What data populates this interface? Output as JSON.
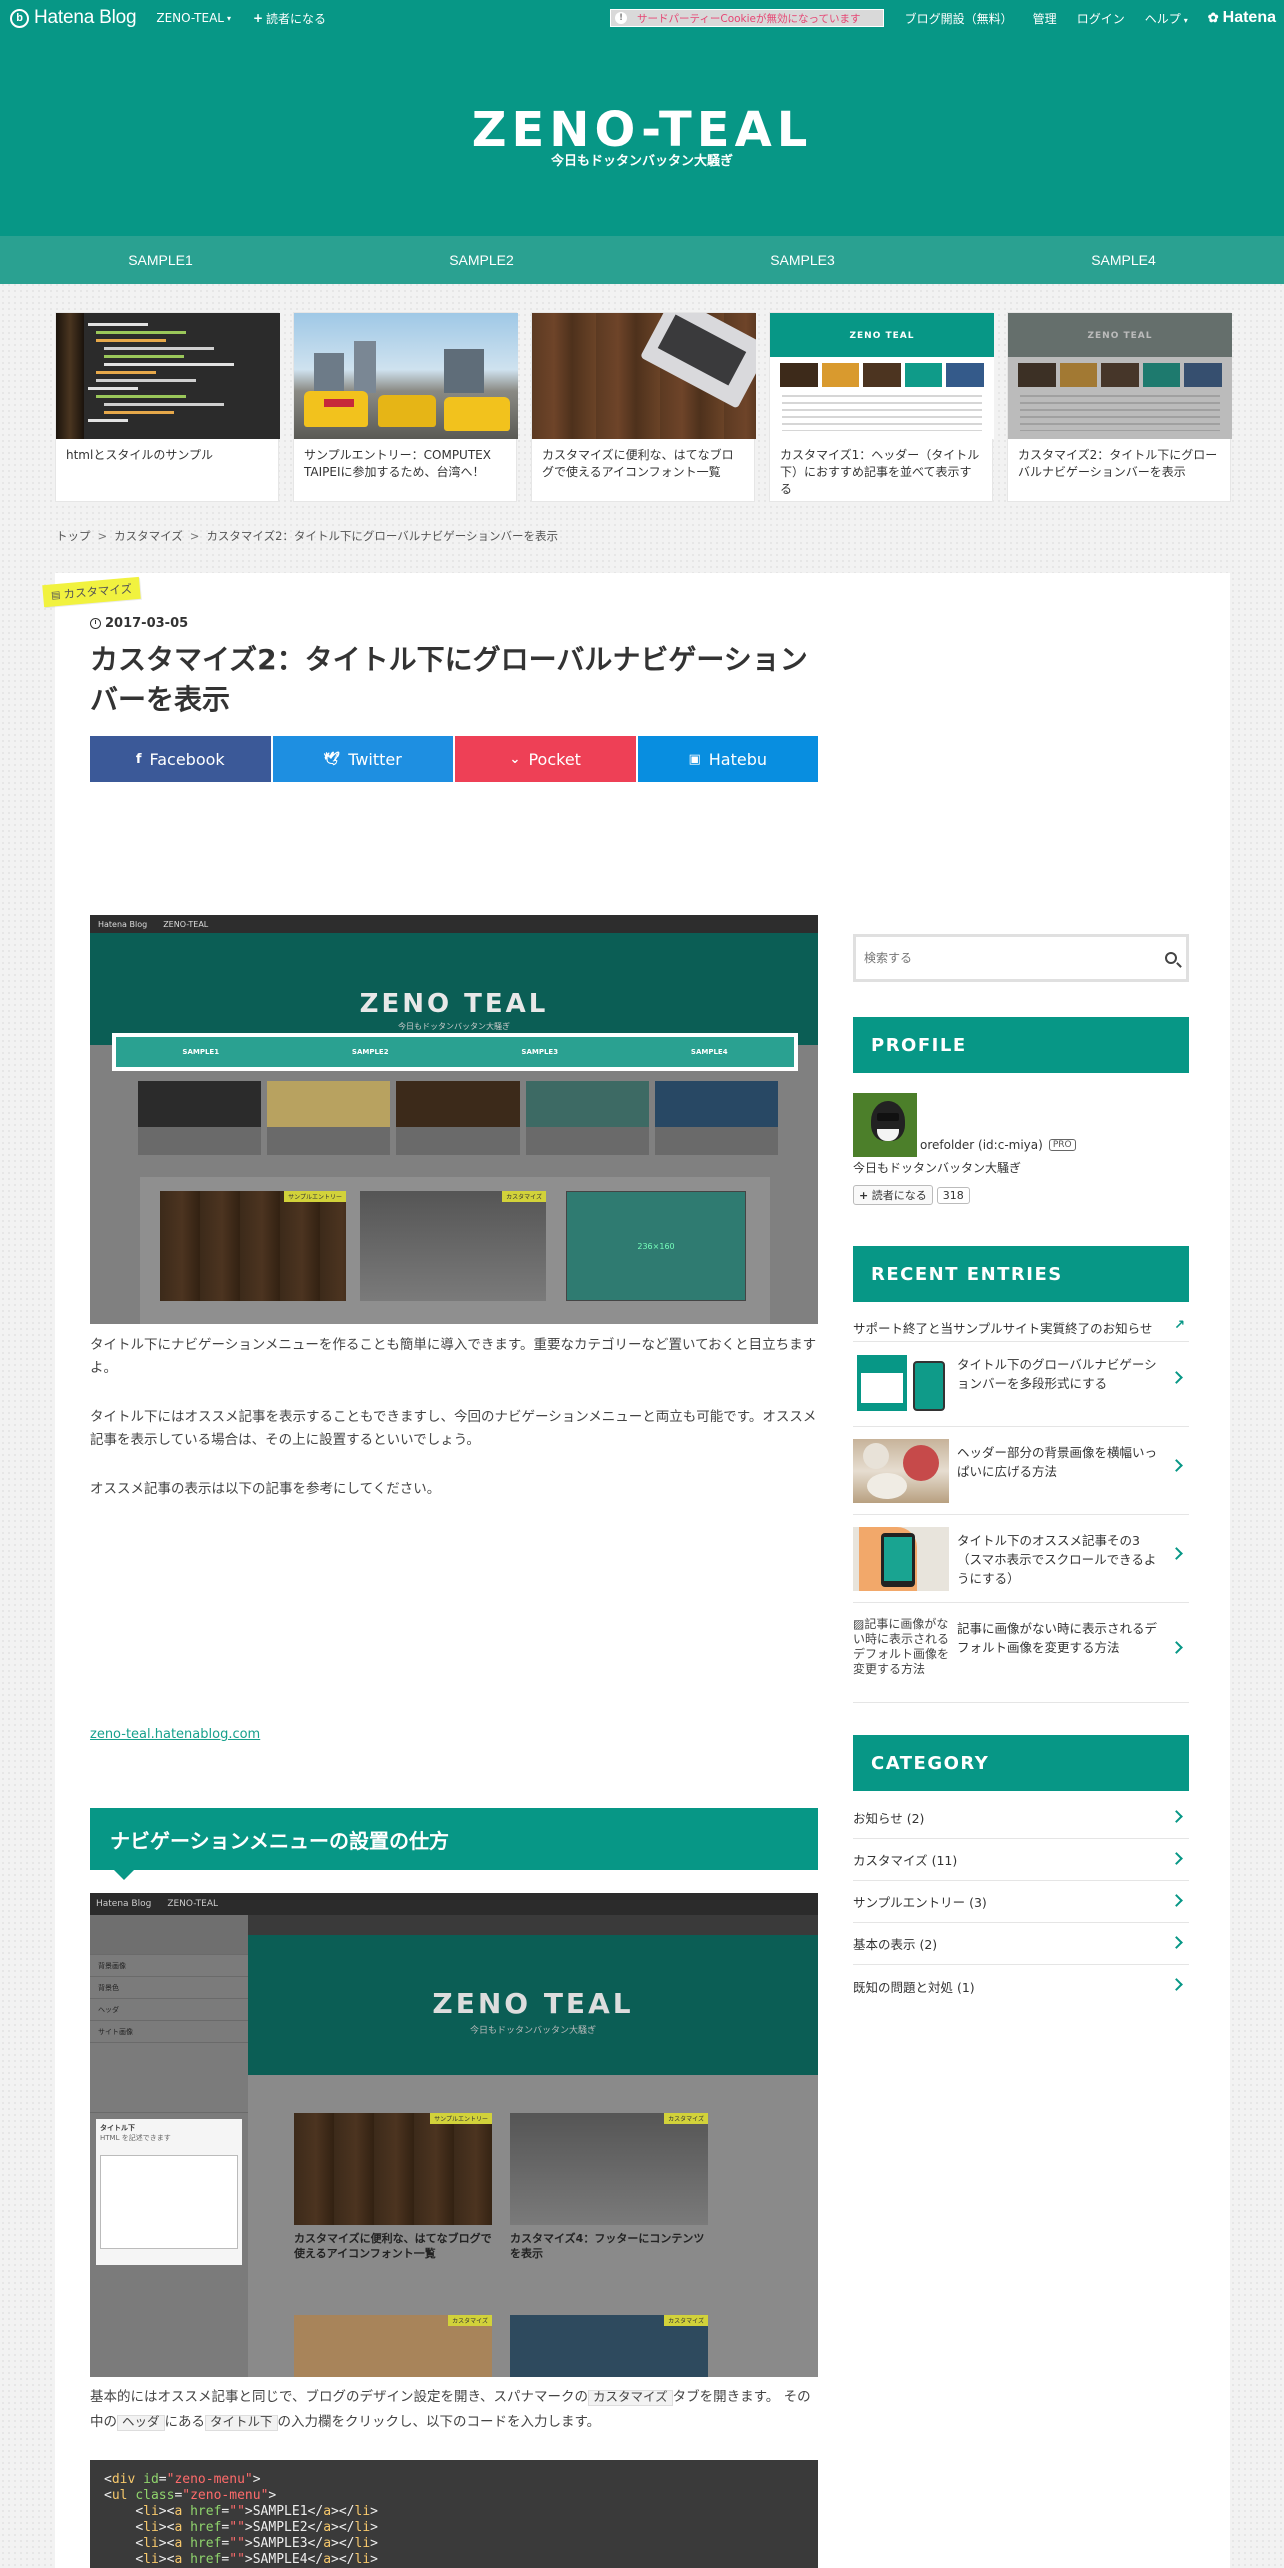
{
  "topbar": {
    "logo_text": "Hatena Blog",
    "blog_selector": "ZENO-TEAL",
    "reader_button": "読者になる",
    "cookie_notice": "サードパーティーCookieが無効になっています",
    "links": [
      "ブログ開設（無料）",
      "管理",
      "ログイン",
      "ヘルプ"
    ],
    "hatena": "Hatena"
  },
  "header": {
    "title": "ZENO-TEAL",
    "description": "今日もドッタンバッタン大騒ぎ"
  },
  "global_nav": [
    "SAMPLE1",
    "SAMPLE2",
    "SAMPLE3",
    "SAMPLE4"
  ],
  "pickup": [
    {
      "title": "htmlとスタイルのサンプル"
    },
    {
      "title": "サンプルエントリー：COMPUTEX TAIPEIに参加するため、台湾へ！"
    },
    {
      "title": "カスタマイズに便利な、はてなブログで使えるアイコンフォント一覧"
    },
    {
      "title": "カスタマイズ1：ヘッダー（タイトル下）におすすめ記事を並べて表示する"
    },
    {
      "title": "カスタマイズ2：タイトル下にグローバルナビゲーションバーを表示"
    }
  ],
  "breadcrumb": [
    "トップ",
    "カスタマイズ",
    "カスタマイズ2：タイトル下にグローバルナビゲーションバーを表示"
  ],
  "entry": {
    "category": "カスタマイズ",
    "date": "2017-03-05",
    "title": "カスタマイズ2：タイトル下にグローバルナビゲーションバーを表示",
    "share": {
      "facebook": "Facebook",
      "twitter": "Twitter",
      "pocket": "Pocket",
      "hatebu": "Hatebu"
    },
    "shot1": {
      "logo": "Hatena Blog",
      "blog": "ZENO-TEAL",
      "title": "ZENO TEAL",
      "desc": "今日もドッタンバッタン大騒ぎ",
      "nav": [
        "SAMPLE1",
        "SAMPLE2",
        "SAMPLE3",
        "SAMPLE4"
      ],
      "tags": [
        "サンプルエントリー",
        "カスタマイズ"
      ],
      "placeholder": "236×160"
    },
    "paragraphs": [
      "タイトル下にナビゲーションメニューを作ることも簡単に導入できます。重要なカテゴリーなど置いておくと目立ちますよ。",
      "タイトル下にはオススメ記事を表示することもできますし、今回のナビゲーションメニューと両立も可能です。オススメ記事を表示している場合は、その上に設置するといいでしょう。",
      "オススメ記事の表示は以下の記事を参考にしてください。"
    ],
    "link": "zeno-teal.hatenablog.com",
    "section_title": "ナビゲーションメニューの設置の仕方",
    "shot2": {
      "logo": "Hatena Blog",
      "blog": "ZENO-TEAL",
      "title": "ZENO TEAL",
      "desc": "今日もドッタンバッタン大騒ぎ",
      "side_rows": [
        "背景画像",
        "背景色",
        "ヘッダ",
        "サイト画像"
      ],
      "side_box_title": "タイトル下",
      "side_box_hint": "HTML を記述できます",
      "card1": "カスタマイズに便利な、はてなブログで使えるアイコンフォント一覧",
      "card2": "カスタマイズ4：フッターにコンテンツを表示",
      "tags": [
        "サンプルエントリー",
        "カスタマイズ"
      ]
    },
    "para2_a": "基本的にはオススメ記事と同じで、ブログのデザイン設定を開き、スパナマークの",
    "para2_code1": "カスタマイズ",
    "para2_b": "タブを開きます。 その中の",
    "para2_code2": "ヘッダ",
    "para2_c": "にある",
    "para2_code3": "タイトル下",
    "para2_d": "の入力欄をクリックし、以下のコードを入力します。",
    "code": {
      "line1_tag": "div",
      "line1_attr": "id",
      "line1_val": "zeno-menu",
      "line2_tag": "ul",
      "line2_attr": "class",
      "line2_val": "zeno-menu",
      "items": [
        "SAMPLE1",
        "SAMPLE2",
        "SAMPLE3",
        "SAMPLE4"
      ]
    }
  },
  "sidebar": {
    "search_placeholder": "検索する",
    "profile": {
      "title": "PROFILE",
      "name": "orefolder (id:c-miya)",
      "badge": "PRO",
      "desc": "今日もドッタンバッタン大騒ぎ",
      "reader_button": "読者になる",
      "reader_count": "318"
    },
    "recent": {
      "title": "RECENT ENTRIES",
      "first": "サポート終了と当サンプルサイト実質終了のお知らせ",
      "items": [
        "タイトル下のグローバルナビゲーションバーを多段形式にする",
        "ヘッダー部分の背景画像を横幅いっぱいに広げる方法",
        "タイトル下のオススメ記事その3（スマホ表示でスクロールできるようにする）",
        "記事に画像がない時に表示されるデフォルト画像を変更する方法"
      ],
      "broken_alt": "記事に画像がない時に表示されるデフォルト画像を変更する方法"
    },
    "category": {
      "title": "CATEGORY",
      "items": [
        "お知らせ (2)",
        "カスタマイズ (11)",
        "サンプルエントリー (3)",
        "基本の表示 (2)",
        "既知の問題と対処 (1)"
      ]
    }
  },
  "colors": {
    "teal": "#079786",
    "nav_teal": "#2aa191",
    "facebook": "#3b5998",
    "twitter": "#1e8fe1",
    "pocket": "#ee4056",
    "hatebu": "#088ee0"
  }
}
